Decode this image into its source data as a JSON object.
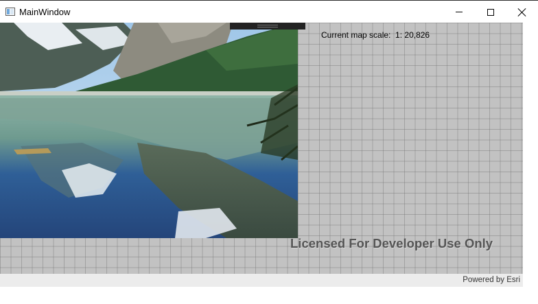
{
  "window": {
    "title": "MainWindow"
  },
  "map": {
    "scale_label": "Current map scale:",
    "scale_value": "1: 20,826",
    "watermark": "Licensed For Developer Use Only",
    "attribution": "Powered by Esri",
    "background_color": "#c2c2c2"
  }
}
